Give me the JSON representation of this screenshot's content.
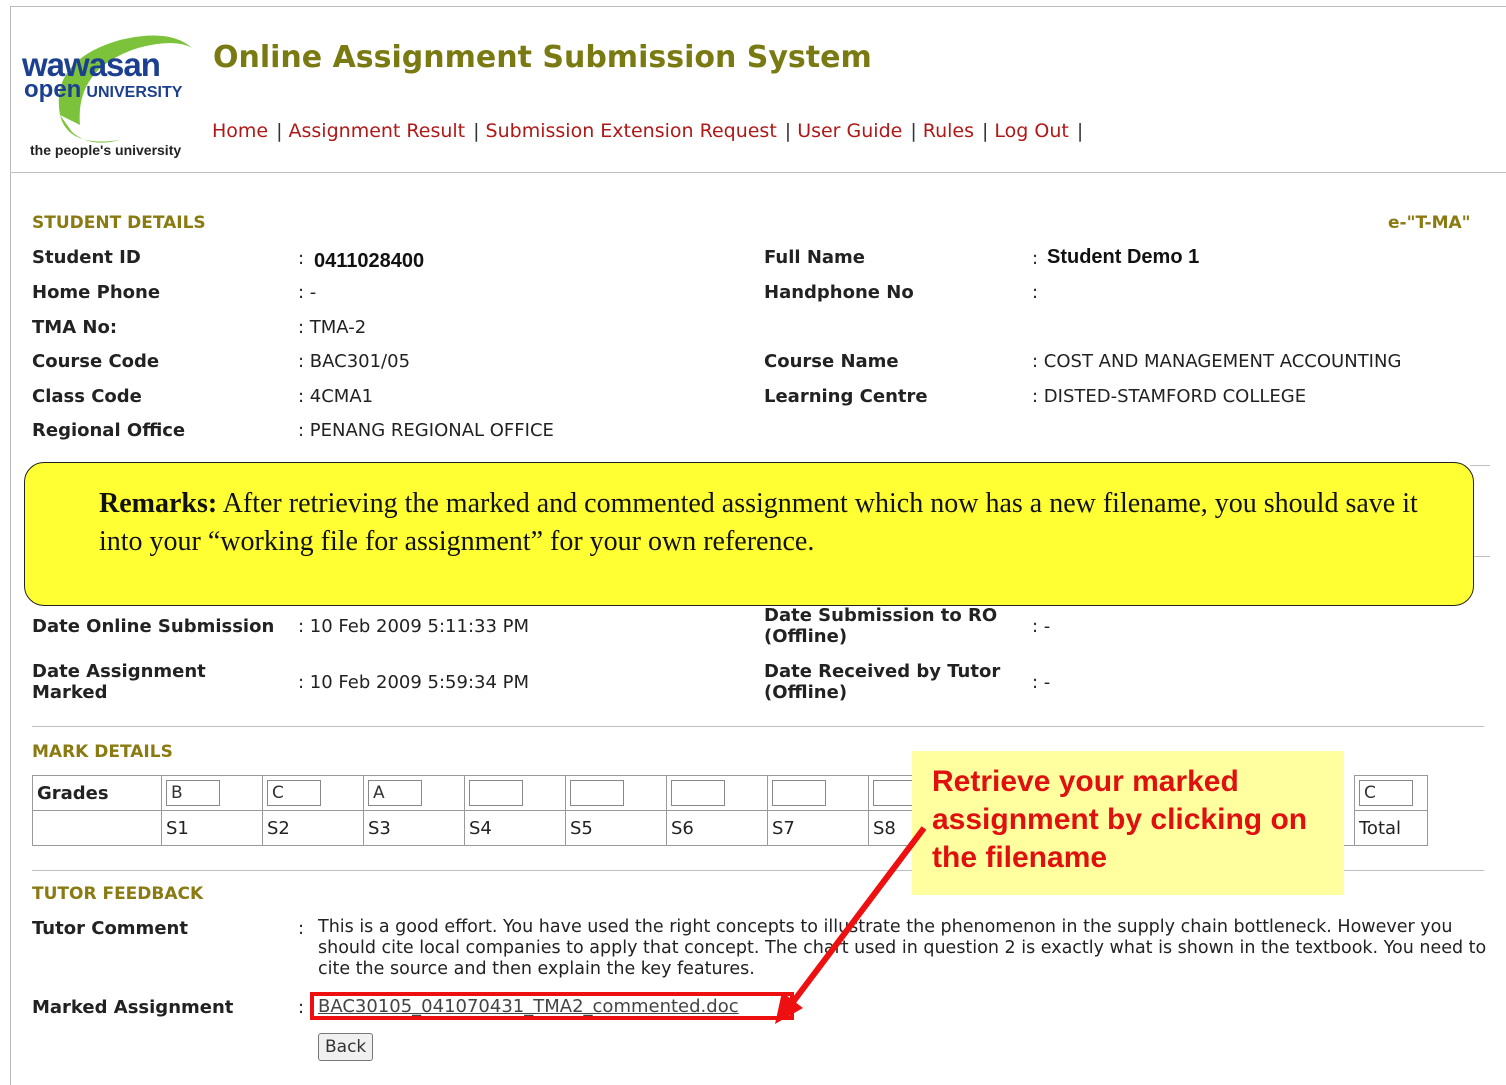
{
  "logo": {
    "line1": "wawasan",
    "line2": "open",
    "line3": "UNIVERSITY",
    "tagline": "the people's university"
  },
  "app_title": "Online Assignment Submission System",
  "nav": [
    "Home",
    "Assignment Result",
    "Submission Extension Request",
    "User Guide",
    "Rules",
    "Log Out"
  ],
  "student": {
    "section_title": "STUDENT DETAILS",
    "etma_tag": "e-\"T-MA\"",
    "student_id_label": "Student ID",
    "student_id": "0411028400",
    "full_name_label": "Full Name",
    "full_name": "Student Demo 1",
    "home_phone_label": "Home Phone",
    "home_phone": ": -",
    "handphone_label": "Handphone No",
    "handphone": ":",
    "tma_no_label": "TMA No:",
    "tma_no": ": TMA-2",
    "course_code_label": "Course Code",
    "course_code": ": BAC301/05",
    "course_name_label": "Course Name",
    "course_name": ": COST AND MANAGEMENT ACCOUNTING",
    "class_code_label": "Class Code",
    "class_code": ": 4CMA1",
    "learning_centre_label": "Learning Centre",
    "learning_centre": ": DISTED-STAMFORD COLLEGE",
    "regional_office_label": "Regional Office",
    "regional_office": ": PENANG REGIONAL OFFICE"
  },
  "remarks": {
    "label": "Remarks:",
    "text": "After retrieving the marked and commented assignment which now has a new filename, you should save it into your “working file for assignment” for your own reference."
  },
  "dates": {
    "online_submission_label": "Date Online Submission",
    "online_submission": ": 10 Feb 2009 5:11:33 PM",
    "submission_ro_label": "Date Submission to RO (Offline)",
    "submission_ro": ": -",
    "marked_label": "Date Assignment Marked",
    "marked": ": 10 Feb 2009 5:59:34 PM",
    "received_tutor_label": "Date Received by Tutor (Offline)",
    "received_tutor": ": -"
  },
  "marks": {
    "section_title": "MARK DETAILS",
    "row_label": "Grades",
    "grades": [
      "B",
      "C",
      "A",
      "",
      "",
      "",
      "",
      ""
    ],
    "sections": [
      "S1",
      "S2",
      "S3",
      "S4",
      "S5",
      "S6",
      "S7",
      "S8"
    ],
    "total_grade": "C",
    "total_label": "Total"
  },
  "callout": "Retrieve your marked assignment by clicking on the filename",
  "feedback": {
    "section_title": "TUTOR FEEDBACK",
    "comment_label": "Tutor Comment",
    "comment": "This is a good effort. You have used the right concepts to illustrate the phenomenon in the supply chain bottleneck. However you should cite local companies to apply that concept. The chart used in question 2 is exactly what is shown in the textbook. You need to cite the source and then explain the key features.",
    "marked_assignment_label": "Marked Assignment",
    "filename": "BAC30105_041070431_TMA2_commented.doc",
    "back_label": "Back"
  },
  "colors": {
    "title": "#7a7a12",
    "nav_link": "#b01818",
    "section": "#8a7a12",
    "highlight": "#ffff33",
    "callout_text": "#e01010"
  }
}
